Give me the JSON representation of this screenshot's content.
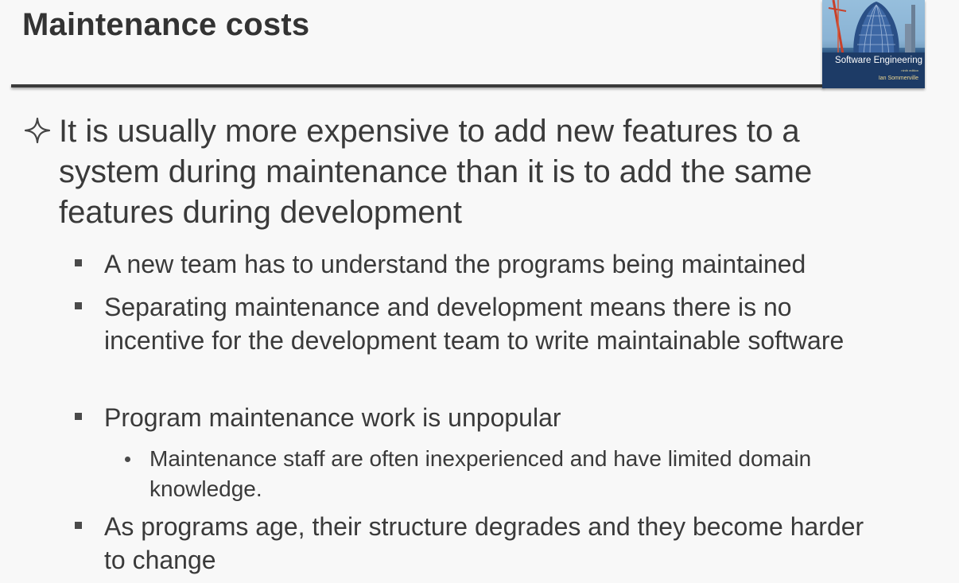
{
  "slide": {
    "title": "Maintenance costs",
    "book_cover": {
      "title": "Software Engineering",
      "edition": "ninth edition",
      "author": "Ian Sommerville"
    },
    "bullets": [
      {
        "level": 1,
        "icon": "four-point-star-icon",
        "text": "It is usually more expensive to add new features to a system during maintenance than it is to add the same features during development"
      },
      {
        "level": 2,
        "icon": "square-bullet-icon",
        "text": "A new team has to understand the programs being maintained"
      },
      {
        "level": 2,
        "icon": "square-bullet-icon",
        "text": "Separating maintenance and development means there is no incentive for the development team to write maintainable software"
      },
      {
        "level": 2,
        "icon": "square-bullet-icon",
        "text": "Program maintenance work is unpopular"
      },
      {
        "level": 3,
        "icon": "round-bullet-icon",
        "text": "Maintenance staff are often inexperienced and have limited domain knowledge."
      },
      {
        "level": 2,
        "icon": "square-bullet-icon",
        "text": "As programs age, their structure degrades and they become harder to change"
      }
    ]
  }
}
